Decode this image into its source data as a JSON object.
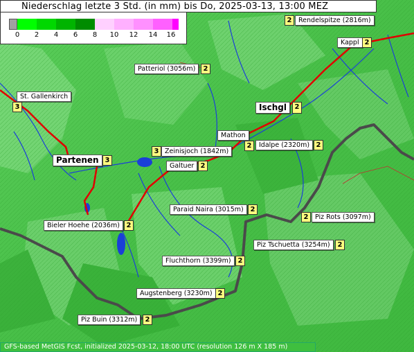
{
  "title": "Niederschlag letzte 3 Std. (in mm) bis Do, 2025-03-13, 13:00 MEZ",
  "legend": {
    "ticks": [
      "0",
      "2",
      "4",
      "6",
      "8",
      "10",
      "12",
      "14",
      "16"
    ],
    "colors": {
      "none": "#a0a0a0",
      "light": "#00ff00",
      "mid": "#00b000",
      "dark": "#008000",
      "pink_light": "#ffb0ff",
      "pink": "#ff60ff",
      "magenta": "#ff00ff"
    }
  },
  "footer": "GFS-based MetGIS Fcst, initialized 2025-03-12, 18:00 UTC  (resolution 126 m X 185 m)",
  "places": [
    {
      "id": "rendelspitze",
      "name": "Rendelspitze (2816m)",
      "value": "2"
    },
    {
      "id": "kappl",
      "name": "Kappl",
      "value": "2"
    },
    {
      "id": "patteriol",
      "name": "Patteriol (3056m)",
      "value": "2"
    },
    {
      "id": "st-gallenkirch",
      "name": "St. Gallenkirch",
      "value": "3"
    },
    {
      "id": "ischgl",
      "name": "Ischgl",
      "value": "2"
    },
    {
      "id": "mathon",
      "name": "Mathon",
      "value": "2"
    },
    {
      "id": "idalpe",
      "name": "Idalpe (2320m)",
      "value": "2"
    },
    {
      "id": "zeinisjoch",
      "name": "Zeinisjoch (1842m)",
      "value": "3"
    },
    {
      "id": "partenen",
      "name": "Partenen",
      "value": "3"
    },
    {
      "id": "galtuer",
      "name": "Galtuer",
      "value": "2"
    },
    {
      "id": "paraid-naira",
      "name": "Paraid Naira (3015m)",
      "value": "2"
    },
    {
      "id": "piz-rots",
      "name": "Piz Rots (3097m)",
      "value": "2"
    },
    {
      "id": "bieler-hoehe",
      "name": "Bieler Hoehe (2036m)",
      "value": "2"
    },
    {
      "id": "piz-tschuetta",
      "name": "Piz Tschuetta (3254m)",
      "value": "2"
    },
    {
      "id": "fluchthorn",
      "name": "Fluchthorn (3399m)",
      "value": "2"
    },
    {
      "id": "augstenberg",
      "name": "Augstenberg (3230m)",
      "value": "2"
    },
    {
      "id": "piz-buin",
      "name": "Piz Buin (3312m)",
      "value": "2"
    }
  ]
}
